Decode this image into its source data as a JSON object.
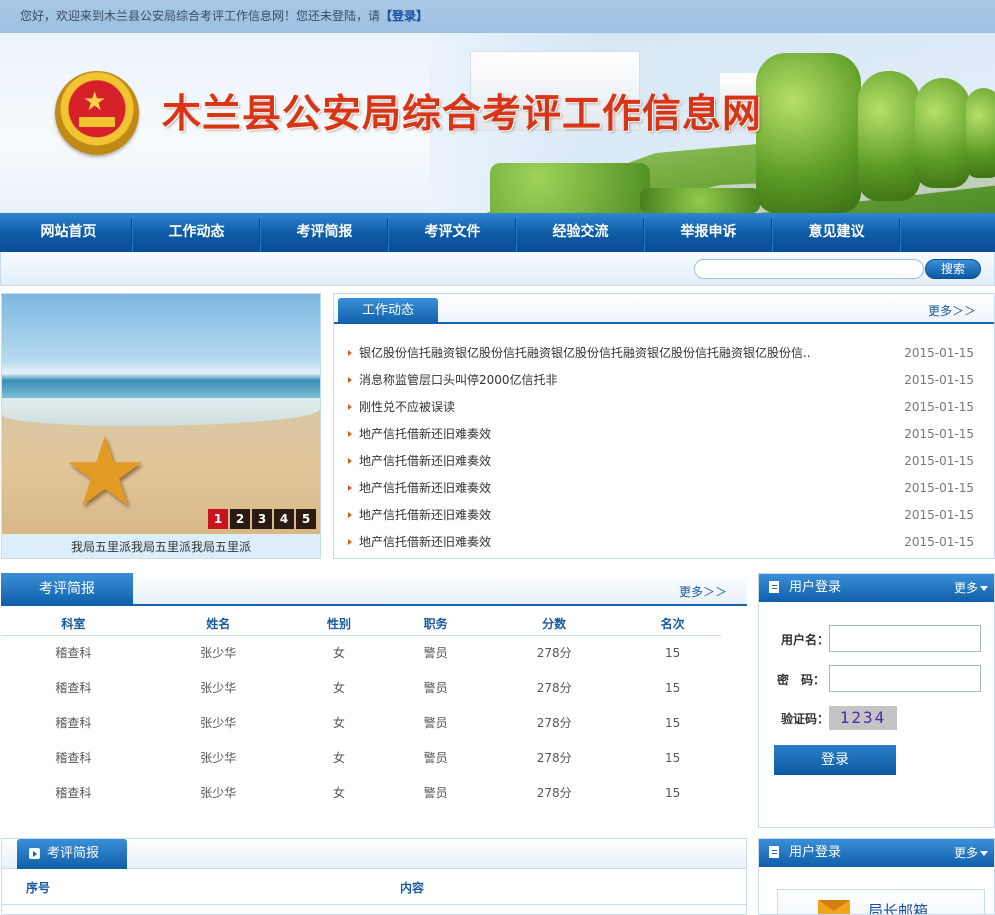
{
  "topbar": {
    "greeting": "您好，欢迎来到木兰县公安局综合考评工作信息网！您还未登陆，请",
    "login_link": "【登录】"
  },
  "header": {
    "site_title": "木兰县公安局综合考评工作信息网"
  },
  "nav": {
    "items": [
      "网站首页",
      "工作动态",
      "考评简报",
      "考评文件",
      "经验交流",
      "举报申诉",
      "意见建议"
    ]
  },
  "search": {
    "value": "",
    "button": "搜索"
  },
  "slider": {
    "pages": [
      "1",
      "2",
      "3",
      "4",
      "5"
    ],
    "active_page": "1",
    "caption": "我局五里派我局五里派我局五里派"
  },
  "news": {
    "tab": "工作动态",
    "more": "更多＞＞",
    "items": [
      {
        "title": "银亿股份信托融资银亿股份信托融资银亿股份信托融资银亿股份信托融资银亿股份信..",
        "date": "2015-01-15"
      },
      {
        "title": "消息称监管层口头叫停2000亿信托非",
        "date": "2015-01-15"
      },
      {
        "title": "刚性兑不应被误读",
        "date": "2015-01-15"
      },
      {
        "title": "地产信托借新还旧难奏效",
        "date": "2015-01-15"
      },
      {
        "title": "地产信托借新还旧难奏效",
        "date": "2015-01-15"
      },
      {
        "title": "地产信托借新还旧难奏效",
        "date": "2015-01-15"
      },
      {
        "title": "地产信托借新还旧难奏效",
        "date": "2015-01-15"
      },
      {
        "title": "地产信托借新还旧难奏效",
        "date": "2015-01-15"
      }
    ]
  },
  "brief": {
    "tab": "考评简报",
    "more": "更多＞＞",
    "columns": [
      "科室",
      "姓名",
      "性别",
      "职务",
      "分数",
      "名次"
    ],
    "rows": [
      [
        "稽查科",
        "张少华",
        "女",
        "警员",
        "278分",
        "15"
      ],
      [
        "稽查科",
        "张少华",
        "女",
        "警员",
        "278分",
        "15"
      ],
      [
        "稽查科",
        "张少华",
        "女",
        "警员",
        "278分",
        "15"
      ],
      [
        "稽查科",
        "张少华",
        "女",
        "警员",
        "278分",
        "15"
      ],
      [
        "稽查科",
        "张少华",
        "女",
        "警员",
        "278分",
        "15"
      ]
    ]
  },
  "login": {
    "title": "用户登录",
    "more": "更多",
    "username_label": "用户名：",
    "password_label": "密　码：",
    "captcha_label": "验证码：",
    "captcha_value": "1234",
    "username_value": "",
    "password_value": "",
    "button": "登录"
  },
  "brief2": {
    "tab": "考评简报",
    "col1": "序号",
    "col2": "内容"
  },
  "login2": {
    "title": "用户登录",
    "more": "更多",
    "mailbox": "局长邮箱"
  }
}
